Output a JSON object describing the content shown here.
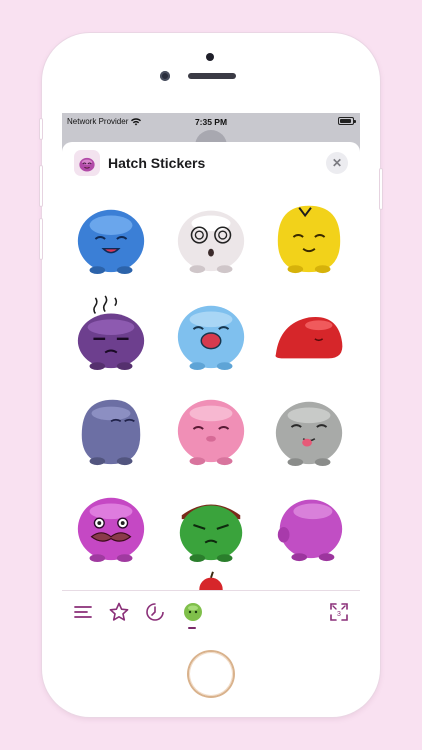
{
  "status_bar": {
    "carrier": "Network Provider",
    "time": "7:35 PM"
  },
  "sheet": {
    "title": "Hatch Stickers"
  },
  "colors": {
    "background": "#f9e1f1",
    "accent": "#7a2a6a",
    "toolbar_icon": "#8a2f78"
  },
  "stickers": [
    {
      "name": "blue-blob-sticker",
      "color": "#3b7fd6"
    },
    {
      "name": "dizzy-white-blob-sticker",
      "color": "#ece6e8"
    },
    {
      "name": "yellow-blob-sticker",
      "color": "#f2d21a"
    },
    {
      "name": "purple-grumpy-blob-sticker",
      "color": "#6d3f8e"
    },
    {
      "name": "lightblue-yawning-blob-sticker",
      "color": "#7fc0ee"
    },
    {
      "name": "red-melting-blob-sticker",
      "color": "#d6262a"
    },
    {
      "name": "slate-blob-sticker",
      "color": "#6c6fa4"
    },
    {
      "name": "pink-blob-sticker",
      "color": "#f08fb6"
    },
    {
      "name": "grey-tongue-blob-sticker",
      "color": "#a8aaa8"
    },
    {
      "name": "magenta-mustache-blob-sticker",
      "color": "#c548c4"
    },
    {
      "name": "green-angry-blob-sticker",
      "color": "#3aa33c"
    },
    {
      "name": "magenta-back-blob-sticker",
      "color": "#c14ec4"
    }
  ],
  "toolbar": {
    "icons": [
      "menu-icon",
      "star-icon",
      "recent-icon",
      "sticker-pack-icon",
      "expand-icon"
    ]
  }
}
